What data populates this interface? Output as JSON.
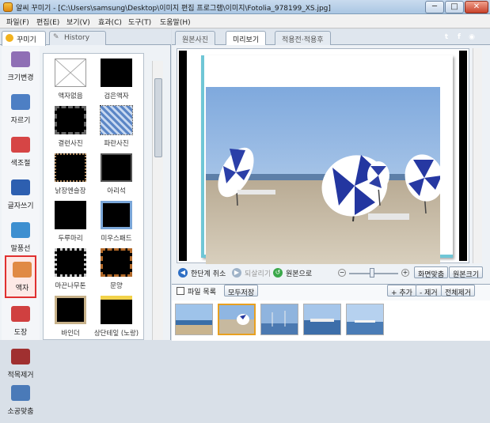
{
  "window": {
    "title": "알씨 꾸미기 - [C:\\Users\\samsung\\Desktop\\이미지 편집 프로그램\\이미지\\Fotolia_978199_XS.jpg]",
    "buttons": [
      "─",
      "□",
      "✕"
    ]
  },
  "menu": [
    "파일(F)",
    "편집(E)",
    "보기(V)",
    "효과(C)",
    "도구(T)",
    "도움말(H)"
  ],
  "left_tabs": [
    "꾸미기",
    "History"
  ],
  "tools": [
    {
      "label": "크기변경",
      "icon": "size-icon",
      "color": "#8f6fb5"
    },
    {
      "label": "자르기",
      "icon": "scissors-icon",
      "color": "#4d7fc4"
    },
    {
      "label": "색조절",
      "icon": "color-bars-icon",
      "color": "#d64545"
    },
    {
      "label": "글자쓰기",
      "icon": "text-t-icon",
      "color": "#2d5fb0"
    },
    {
      "label": "말풍선",
      "icon": "speech-bubble-icon",
      "color": "#3d8fd0"
    },
    {
      "label": "액자",
      "icon": "frame-icon",
      "color": "#e08a45"
    },
    {
      "label": "도장",
      "icon": "stamp-icon",
      "color": "#d04040"
    },
    {
      "label": "적목제거",
      "icon": "eye-icon",
      "color": "#a03030"
    },
    {
      "label": "소공맞춤",
      "icon": "adjust-icon",
      "color": "#4a7ab8"
    }
  ],
  "frames": [
    {
      "label": "액자없음",
      "style": "none"
    },
    {
      "label": "검은액자",
      "style": "black"
    },
    {
      "label": "결런사진",
      "style": "film"
    },
    {
      "label": "파란사진",
      "style": "blue"
    },
    {
      "label": "낡장엔슬장",
      "style": "dotted"
    },
    {
      "label": "아리석",
      "style": "thin"
    },
    {
      "label": "두루마리",
      "style": "dark"
    },
    {
      "label": "미우스패드",
      "style": "pad"
    },
    {
      "label": "마끈나무톤",
      "style": "lace"
    },
    {
      "label": "문양",
      "style": "pattern"
    },
    {
      "label": "바인더",
      "style": "binder"
    },
    {
      "label": "상단테잎\n(노랑)",
      "style": "tape"
    }
  ],
  "right_tabs": [
    "원본사진",
    "미리보기",
    "적용전·적용후"
  ],
  "sns": [
    {
      "icon": "twitter-icon",
      "text": "t",
      "color": "#3ea7e8"
    },
    {
      "icon": "facebook-icon",
      "text": "f",
      "color": "#3b5da2"
    },
    {
      "icon": "share-icon",
      "text": "◉",
      "color": "#e07a2a"
    }
  ],
  "view_bar": {
    "undo": "한단계 취소",
    "redo": "되살리기",
    "original": "원본으로",
    "fit": "화면맞춤",
    "actual": "원본크기"
  },
  "file_bar": {
    "title": "파일 목록",
    "save_all": "모두저장",
    "add": "+ 추가",
    "remove": "- 제거",
    "remove_all": "전체제거"
  }
}
